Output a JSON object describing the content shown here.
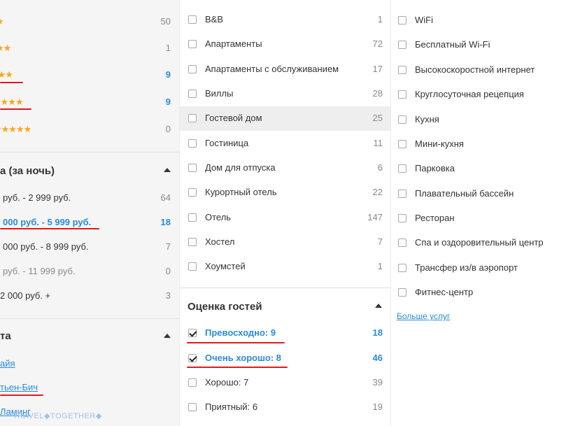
{
  "stars_filter": {
    "items": [
      {
        "stars": "★",
        "count": "50"
      },
      {
        "stars": "★★",
        "count": "1"
      },
      {
        "stars": "★★★",
        "count": "9"
      },
      {
        "stars": "★★★★",
        "count": "9"
      },
      {
        "stars": "★★★★★",
        "count": "0"
      }
    ]
  },
  "price_filter": {
    "title": "а (за ночь)",
    "items": [
      {
        "label": "руб. - 2 999 руб.",
        "count": "64"
      },
      {
        "label": "000 руб. - 5 999 руб.",
        "count": "18"
      },
      {
        "label": "000 руб. - 8 999 руб.",
        "count": "7"
      },
      {
        "label": "руб. - 11 999 руб.",
        "count": "0"
      },
      {
        "label": "2 000 руб. +",
        "count": "3"
      }
    ]
  },
  "district_filter": {
    "title": "та",
    "items": [
      "айя",
      "тьен-Бич",
      "Ламинг"
    ]
  },
  "property_type": {
    "items": [
      {
        "label": "B&B",
        "count": "1"
      },
      {
        "label": "Апартаменты",
        "count": "72"
      },
      {
        "label": "Апартаменты с обслуживанием",
        "count": "17"
      },
      {
        "label": "Виллы",
        "count": "28"
      },
      {
        "label": "Гостевой дом",
        "count": "25"
      },
      {
        "label": "Гостиница",
        "count": "11"
      },
      {
        "label": "Дом для отпуска",
        "count": "6"
      },
      {
        "label": "Курортный отель",
        "count": "22"
      },
      {
        "label": "Отель",
        "count": "147"
      },
      {
        "label": "Хостел",
        "count": "7"
      },
      {
        "label": "Хоумстей",
        "count": "1"
      }
    ]
  },
  "guest_rating": {
    "title": "Оценка гостей",
    "items": [
      {
        "label": "Превосходно: 9",
        "count": "18",
        "checked": true
      },
      {
        "label": "Очень хорошо: 8",
        "count": "46",
        "checked": true
      },
      {
        "label": "Хорошо: 7",
        "count": "39",
        "checked": false
      },
      {
        "label": "Приятный: 6",
        "count": "19",
        "checked": false
      }
    ]
  },
  "facilities": {
    "items": [
      "WiFi",
      "Бесплатный Wi-Fi",
      "Высокоскоростной интернет",
      "Круглосуточная рецепция",
      "Кухня",
      "Мини-кухня",
      "Парковка",
      "Плавательный бассейн",
      "Ресторан",
      "Спа и оздоровительный центр",
      "Трансфер из/в аэропорт",
      "Фитнес-центр"
    ],
    "more_link": "Больше услуг"
  },
  "watermark": "TRAVEL◆TOGETHER◆",
  "colors": {
    "accent": "#2a8bd8",
    "star": "#f7a81b",
    "annotation": "#e01b1b"
  }
}
